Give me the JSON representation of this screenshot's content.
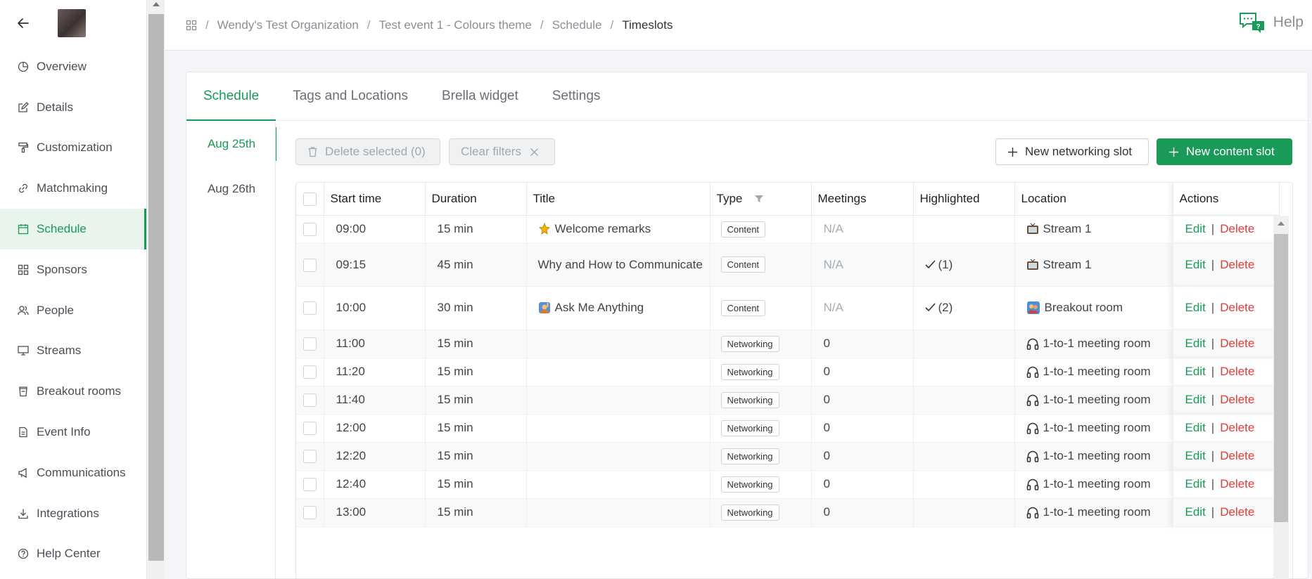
{
  "sidebar": {
    "items": [
      {
        "label": "Overview",
        "icon": "pie-chart-icon",
        "active": false
      },
      {
        "label": "Details",
        "icon": "edit-icon",
        "active": false
      },
      {
        "label": "Customization",
        "icon": "paint-roller-icon",
        "active": false
      },
      {
        "label": "Matchmaking",
        "icon": "link-icon",
        "active": false
      },
      {
        "label": "Schedule",
        "icon": "calendar-icon",
        "active": true
      },
      {
        "label": "Sponsors",
        "icon": "grid-icon",
        "active": false
      },
      {
        "label": "People",
        "icon": "people-icon",
        "active": false
      },
      {
        "label": "Streams",
        "icon": "monitor-icon",
        "active": false
      },
      {
        "label": "Breakout rooms",
        "icon": "cup-icon",
        "active": false
      },
      {
        "label": "Event Info",
        "icon": "document-icon",
        "active": false
      },
      {
        "label": "Communications",
        "icon": "megaphone-icon",
        "active": false
      },
      {
        "label": "Integrations",
        "icon": "download-icon",
        "active": false
      },
      {
        "label": "Help Center",
        "icon": "question-icon",
        "active": false
      }
    ]
  },
  "breadcrumb": {
    "items": [
      "Wendy's Test Organization",
      "Test event 1 - Colours theme",
      "Schedule"
    ],
    "current": "Timeslots",
    "separator": "/"
  },
  "help": {
    "label": "Help"
  },
  "tabs": [
    {
      "label": "Schedule",
      "active": true
    },
    {
      "label": "Tags and Locations",
      "active": false
    },
    {
      "label": "Brella widget",
      "active": false
    },
    {
      "label": "Settings",
      "active": false
    }
  ],
  "dates": [
    {
      "label": "Aug 25th",
      "active": true
    },
    {
      "label": "Aug 26th",
      "active": false
    }
  ],
  "toolbar": {
    "delete_selected": "Delete selected (0)",
    "clear_filters": "Clear filters",
    "new_networking": "New networking slot",
    "new_content": "New content slot"
  },
  "table": {
    "headers": {
      "start_time": "Start time",
      "duration": "Duration",
      "title": "Title",
      "type": "Type",
      "meetings": "Meetings",
      "highlighted": "Highlighted",
      "location": "Location",
      "actions": "Actions"
    },
    "edit_label": "Edit",
    "separator": "|",
    "delete_label": "Delete",
    "rows": [
      {
        "start": "09:00",
        "duration": "15 min",
        "title": "Welcome remarks",
        "title_icon": "sparkle-icon",
        "type": "Content",
        "meetings": "N/A",
        "highlighted": "",
        "location": "Stream 1",
        "location_icon": "tv-icon"
      },
      {
        "start": "09:15",
        "duration": "45 min",
        "title": "Why and How to Communicate",
        "title_icon": "",
        "type": "Content",
        "meetings": "N/A",
        "highlighted": "(1)",
        "location": "Stream 1",
        "location_icon": "tv-icon"
      },
      {
        "start": "10:00",
        "duration": "30 min",
        "title": "Ask Me Anything",
        "title_icon": "raised-hand-icon",
        "type": "Content",
        "meetings": "N/A",
        "highlighted": "(2)",
        "location": "Breakout room",
        "location_icon": "people-emoji-icon"
      },
      {
        "start": "11:00",
        "duration": "15 min",
        "title": "",
        "title_icon": "",
        "type": "Networking",
        "meetings": "0",
        "highlighted": "",
        "location": "1-to-1 meeting room",
        "location_icon": "headphones-icon"
      },
      {
        "start": "11:20",
        "duration": "15 min",
        "title": "",
        "title_icon": "",
        "type": "Networking",
        "meetings": "0",
        "highlighted": "",
        "location": "1-to-1 meeting room",
        "location_icon": "headphones-icon"
      },
      {
        "start": "11:40",
        "duration": "15 min",
        "title": "",
        "title_icon": "",
        "type": "Networking",
        "meetings": "0",
        "highlighted": "",
        "location": "1-to-1 meeting room",
        "location_icon": "headphones-icon"
      },
      {
        "start": "12:00",
        "duration": "15 min",
        "title": "",
        "title_icon": "",
        "type": "Networking",
        "meetings": "0",
        "highlighted": "",
        "location": "1-to-1 meeting room",
        "location_icon": "headphones-icon"
      },
      {
        "start": "12:20",
        "duration": "15 min",
        "title": "",
        "title_icon": "",
        "type": "Networking",
        "meetings": "0",
        "highlighted": "",
        "location": "1-to-1 meeting room",
        "location_icon": "headphones-icon"
      },
      {
        "start": "12:40",
        "duration": "15 min",
        "title": "",
        "title_icon": "",
        "type": "Networking",
        "meetings": "0",
        "highlighted": "",
        "location": "1-to-1 meeting room",
        "location_icon": "headphones-icon"
      },
      {
        "start": "13:00",
        "duration": "15 min",
        "title": "",
        "title_icon": "",
        "type": "Networking",
        "meetings": "0",
        "highlighted": "",
        "location": "1-to-1 meeting room",
        "location_icon": "headphones-icon"
      }
    ]
  },
  "colors": {
    "accent": "#1a9a58",
    "danger": "#e03b3b"
  }
}
